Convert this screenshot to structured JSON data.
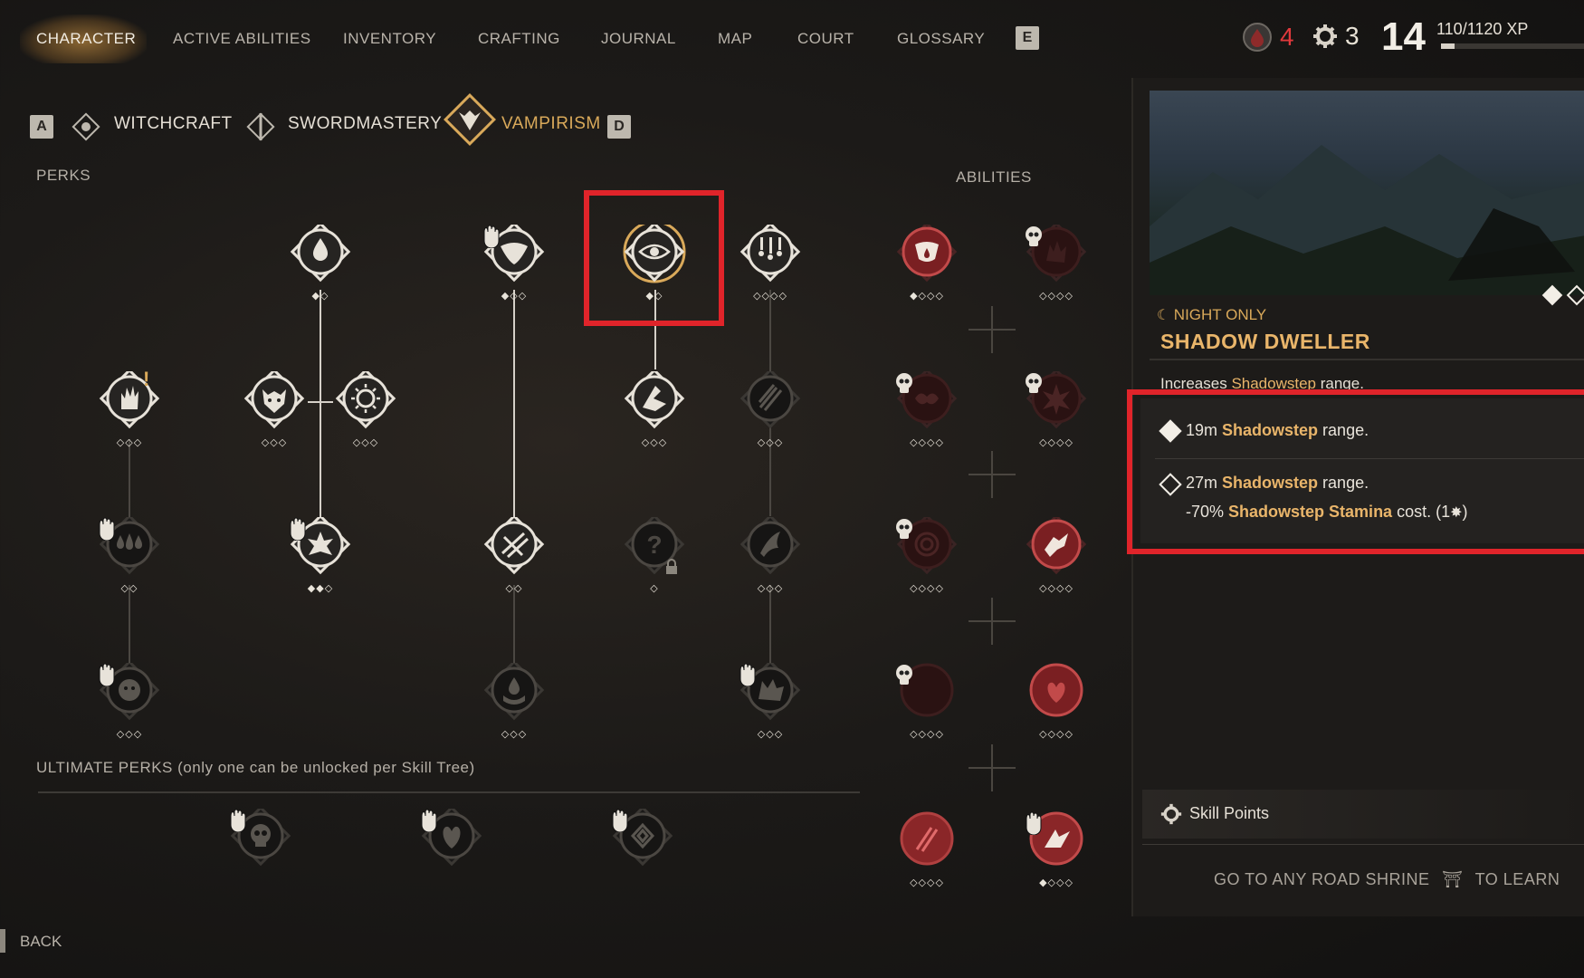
{
  "nav": {
    "tabs": [
      "CHARACTER",
      "ACTIVE ABILITIES",
      "INVENTORY",
      "CRAFTING",
      "JOURNAL",
      "MAP",
      "COURT",
      "GLOSSARY"
    ],
    "key_next": "E",
    "status": {
      "blood_count": "4",
      "skill_points": "3",
      "level": "14",
      "xp": "110/1120 XP",
      "xp_progress": 0.098
    }
  },
  "trees": {
    "key_prev": "A",
    "key_next": "D",
    "tabs": [
      "WITCHCRAFT",
      "SWORDMASTERY",
      "VAMPIRISM"
    ],
    "active": "VAMPIRISM"
  },
  "labels": {
    "perks": "PERKS",
    "abilities": "ABILITIES",
    "ultimate": "ULTIMATE PERKS (only one can be unlocked per Skill Tree)",
    "back": "BACK"
  },
  "perk_nodes": [
    {
      "id": "blood-drop-perk",
      "pips": "◆◇"
    },
    {
      "id": "fang-perk",
      "pips": "◆◇◇"
    },
    {
      "id": "shadow-dweller-perk",
      "pips": "◆◇"
    },
    {
      "id": "blood-rain-perk",
      "pips": "◇◇◇◇"
    },
    {
      "id": "flame-hand-perk",
      "pips": "◇◇◇"
    },
    {
      "id": "demon-mask-perk",
      "pips": "◇◇◇"
    },
    {
      "id": "sun-eye-perk",
      "pips": "◇◇◇"
    },
    {
      "id": "shadowstep-perk",
      "pips": "◇◇◇"
    },
    {
      "id": "claw-marks-perk",
      "pips": "◇◇◇"
    },
    {
      "id": "triple-drop-perk",
      "pips": "◇◇"
    },
    {
      "id": "bloom-perk",
      "pips": "◆◆◇"
    },
    {
      "id": "slash-perk",
      "pips": "◇◇"
    },
    {
      "id": "locked-perk",
      "pips": "◇"
    },
    {
      "id": "talon-perk",
      "pips": "◇◇◇"
    },
    {
      "id": "beast-face-perk",
      "pips": "◇◇◇"
    },
    {
      "id": "hand-drop-perk",
      "pips": "◇◇◇"
    },
    {
      "id": "wolf-perk",
      "pips": "◇◇◇"
    }
  ],
  "ability_nodes": [
    {
      "id": "fanged-maw-ability",
      "pips": "◆◇◇◇"
    },
    {
      "id": "shadow-hand-ability",
      "pips": "◇◇◇◇"
    },
    {
      "id": "bat-swarm-ability",
      "pips": "◇◇◇◇"
    },
    {
      "id": "blood-burst-ability",
      "pips": "◇◇◇◇"
    },
    {
      "id": "vortex-ability",
      "pips": "◇◇◇◇"
    },
    {
      "id": "pounce-ability",
      "pips": "◇◇◇◇"
    },
    {
      "id": "dark-orb-ability",
      "pips": "◇◇◇◇"
    },
    {
      "id": "heart-ability",
      "pips": "◇◇◇◇"
    },
    {
      "id": "claw-strike-ability",
      "pips": "◇◇◇◇"
    },
    {
      "id": "rend-ability",
      "pips": "◆◇◇◇"
    }
  ],
  "ultimate_nodes": [
    {
      "id": "skull-ultimate"
    },
    {
      "id": "heart-ultimate"
    },
    {
      "id": "spiral-ultimate"
    }
  ],
  "detail": {
    "tag": "NIGHT ONLY",
    "title": "SHADOW DWELLER",
    "desc_prefix": "Increases ",
    "desc_highlight": "Shadowstep",
    "desc_suffix": " range.",
    "rank1_prefix": "19m ",
    "rank1_highlight": "Shadowstep",
    "rank1_suffix": " range.",
    "rank2_prefix": "27m ",
    "rank2_highlight": "Shadowstep",
    "rank2_suffix": " range.",
    "rank2b_prefix": "-70% ",
    "rank2b_highlight": "Shadowstep Stamina",
    "rank2b_suffix": " cost. (1",
    "rank2b_end": ")",
    "skill_points_label": "Skill Points",
    "learn_prefix": "GO TO ANY ROAD SHRINE",
    "learn_suffix": "TO LEARN"
  },
  "colors": {
    "accent_gold": "#d9a95a",
    "highlight_red": "#e0242a",
    "keyword": "#e9b56a"
  }
}
